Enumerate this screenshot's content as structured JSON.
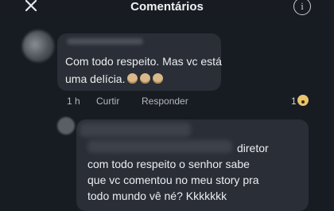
{
  "header": {
    "title": "Comentários",
    "info_label": "i"
  },
  "comment1": {
    "text": "Com todo respeito. Mas vc está uma delícia.",
    "time": "1 h",
    "like_label": "Curtir",
    "reply_label": "Responder",
    "reaction_count": "1"
  },
  "comment2": {
    "lines": [
      "diretor",
      "com todo respeito  o senhor sabe",
      "que vc comentou no meu story pra",
      "todo mundo vê né? Kkkkkkk"
    ]
  }
}
